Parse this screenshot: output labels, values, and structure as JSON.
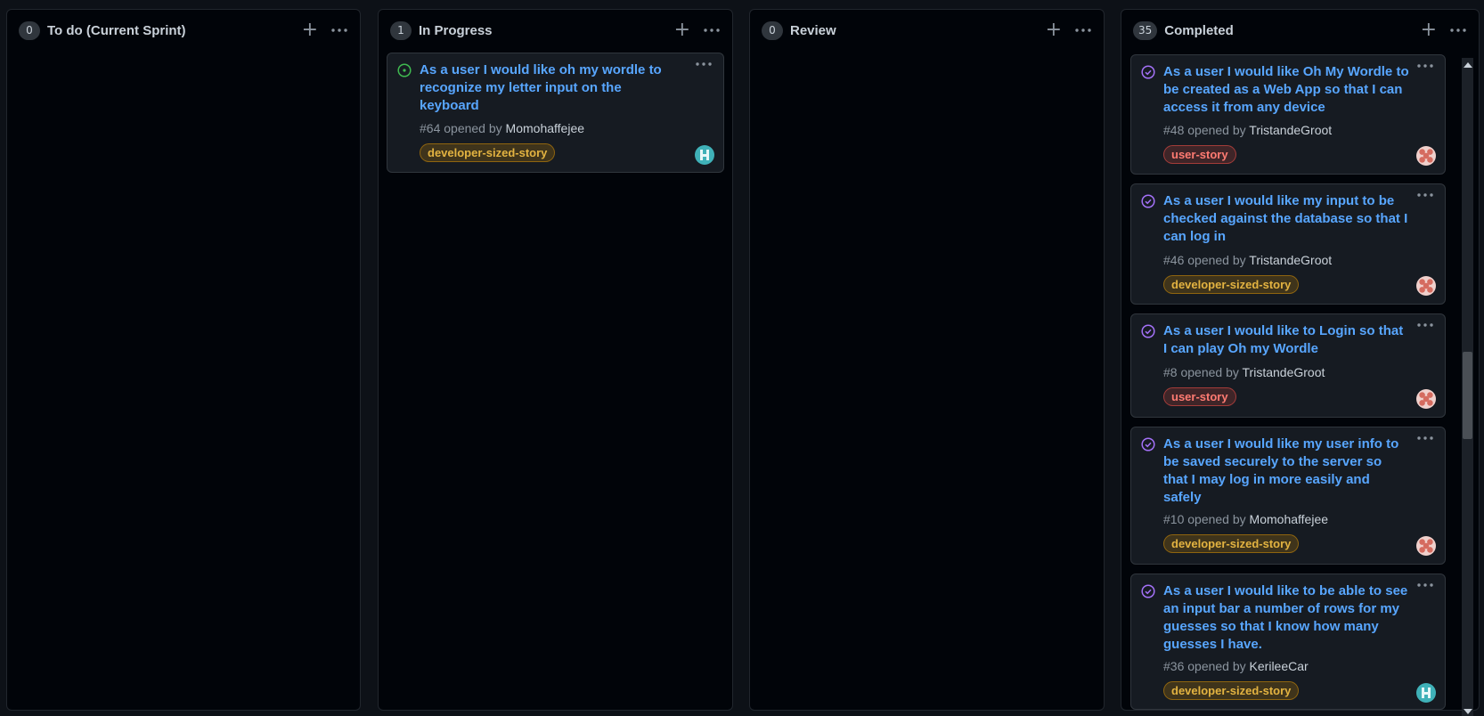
{
  "columns": [
    {
      "title": "To do (Current Sprint)",
      "count": "0"
    },
    {
      "title": "In Progress",
      "count": "1"
    },
    {
      "title": "Review",
      "count": "0"
    },
    {
      "title": "Completed",
      "count": "35"
    }
  ],
  "header_actions": {
    "add": "+",
    "more": "more-horizontal-icon"
  },
  "in_progress_cards": [
    {
      "title": "As a user I would like oh my wordle to recognize my letter input on the keyboard",
      "number": "#64",
      "opened_by_text": "opened by",
      "user": "Momohaffejee",
      "label": "developer-sized-story",
      "status_icon": "issue-open-icon",
      "avatar": "teal-avatar"
    }
  ],
  "completed_cards": [
    {
      "title": "As a user I would like Oh My Wordle to be created as a Web App so that I can access it from any device",
      "number": "#48",
      "opened_by_text": "opened by",
      "user": "TristandeGroot",
      "label": "user-story"
    },
    {
      "title": "As a user I would like my input to be checked against the database so that I can log in",
      "number": "#46",
      "opened_by_text": "opened by",
      "user": "TristandeGroot",
      "label": "developer-sized-story"
    },
    {
      "title": "As a user I would like to Login so that I can play Oh my Wordle",
      "number": "#8",
      "opened_by_text": "opened by",
      "user": "TristandeGroot",
      "label": "user-story"
    },
    {
      "title": "As a user I would like my user info to be saved securely to the server so that I may log in more easily and safely",
      "number": "#10",
      "opened_by_text": "opened by",
      "user": "Momohaffejee",
      "label": "developer-sized-story"
    },
    {
      "title": "As a user I would like to be able to see an input bar a number of rows for my guesses so that I know how many guesses I have.",
      "number": "#36",
      "opened_by_text": "opened by",
      "user": "KerileeCar",
      "label": "developer-sized-story"
    }
  ],
  "colors": {
    "open_icon": "#3fb950",
    "closed_icon": "#a371f7",
    "title_link": "#58a6ff"
  }
}
